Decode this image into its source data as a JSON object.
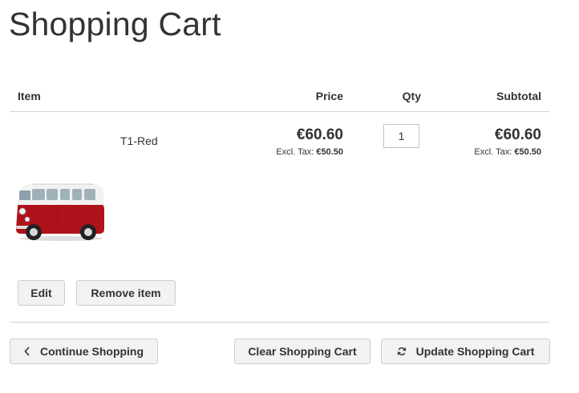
{
  "page": {
    "title": "Shopping Cart"
  },
  "table": {
    "headers": {
      "item": "Item",
      "price": "Price",
      "qty": "Qty",
      "subtotal": "Subtotal"
    },
    "rows": [
      {
        "name": "T1-Red",
        "price": "€60.60",
        "price_excl_label": "Excl. Tax:",
        "price_excl": "€50.50",
        "qty": "1",
        "subtotal": "€60.60",
        "subtotal_excl_label": "Excl. Tax:",
        "subtotal_excl": "€50.50",
        "image_icon": "red-van-product-image",
        "actions": {
          "edit_label": "Edit",
          "remove_label": "Remove item"
        }
      }
    ]
  },
  "footer": {
    "continue_label": "Continue Shopping",
    "continue_icon": "chevron-left-icon",
    "clear_label": "Clear Shopping Cart",
    "update_label": "Update Shopping Cart",
    "update_icon": "refresh-icon"
  },
  "colors": {
    "text": "#333333",
    "button_bg": "#f2f2f2",
    "button_border": "#cdcdcd",
    "divider": "#d1d1d1",
    "van_red": "#b0121b"
  }
}
